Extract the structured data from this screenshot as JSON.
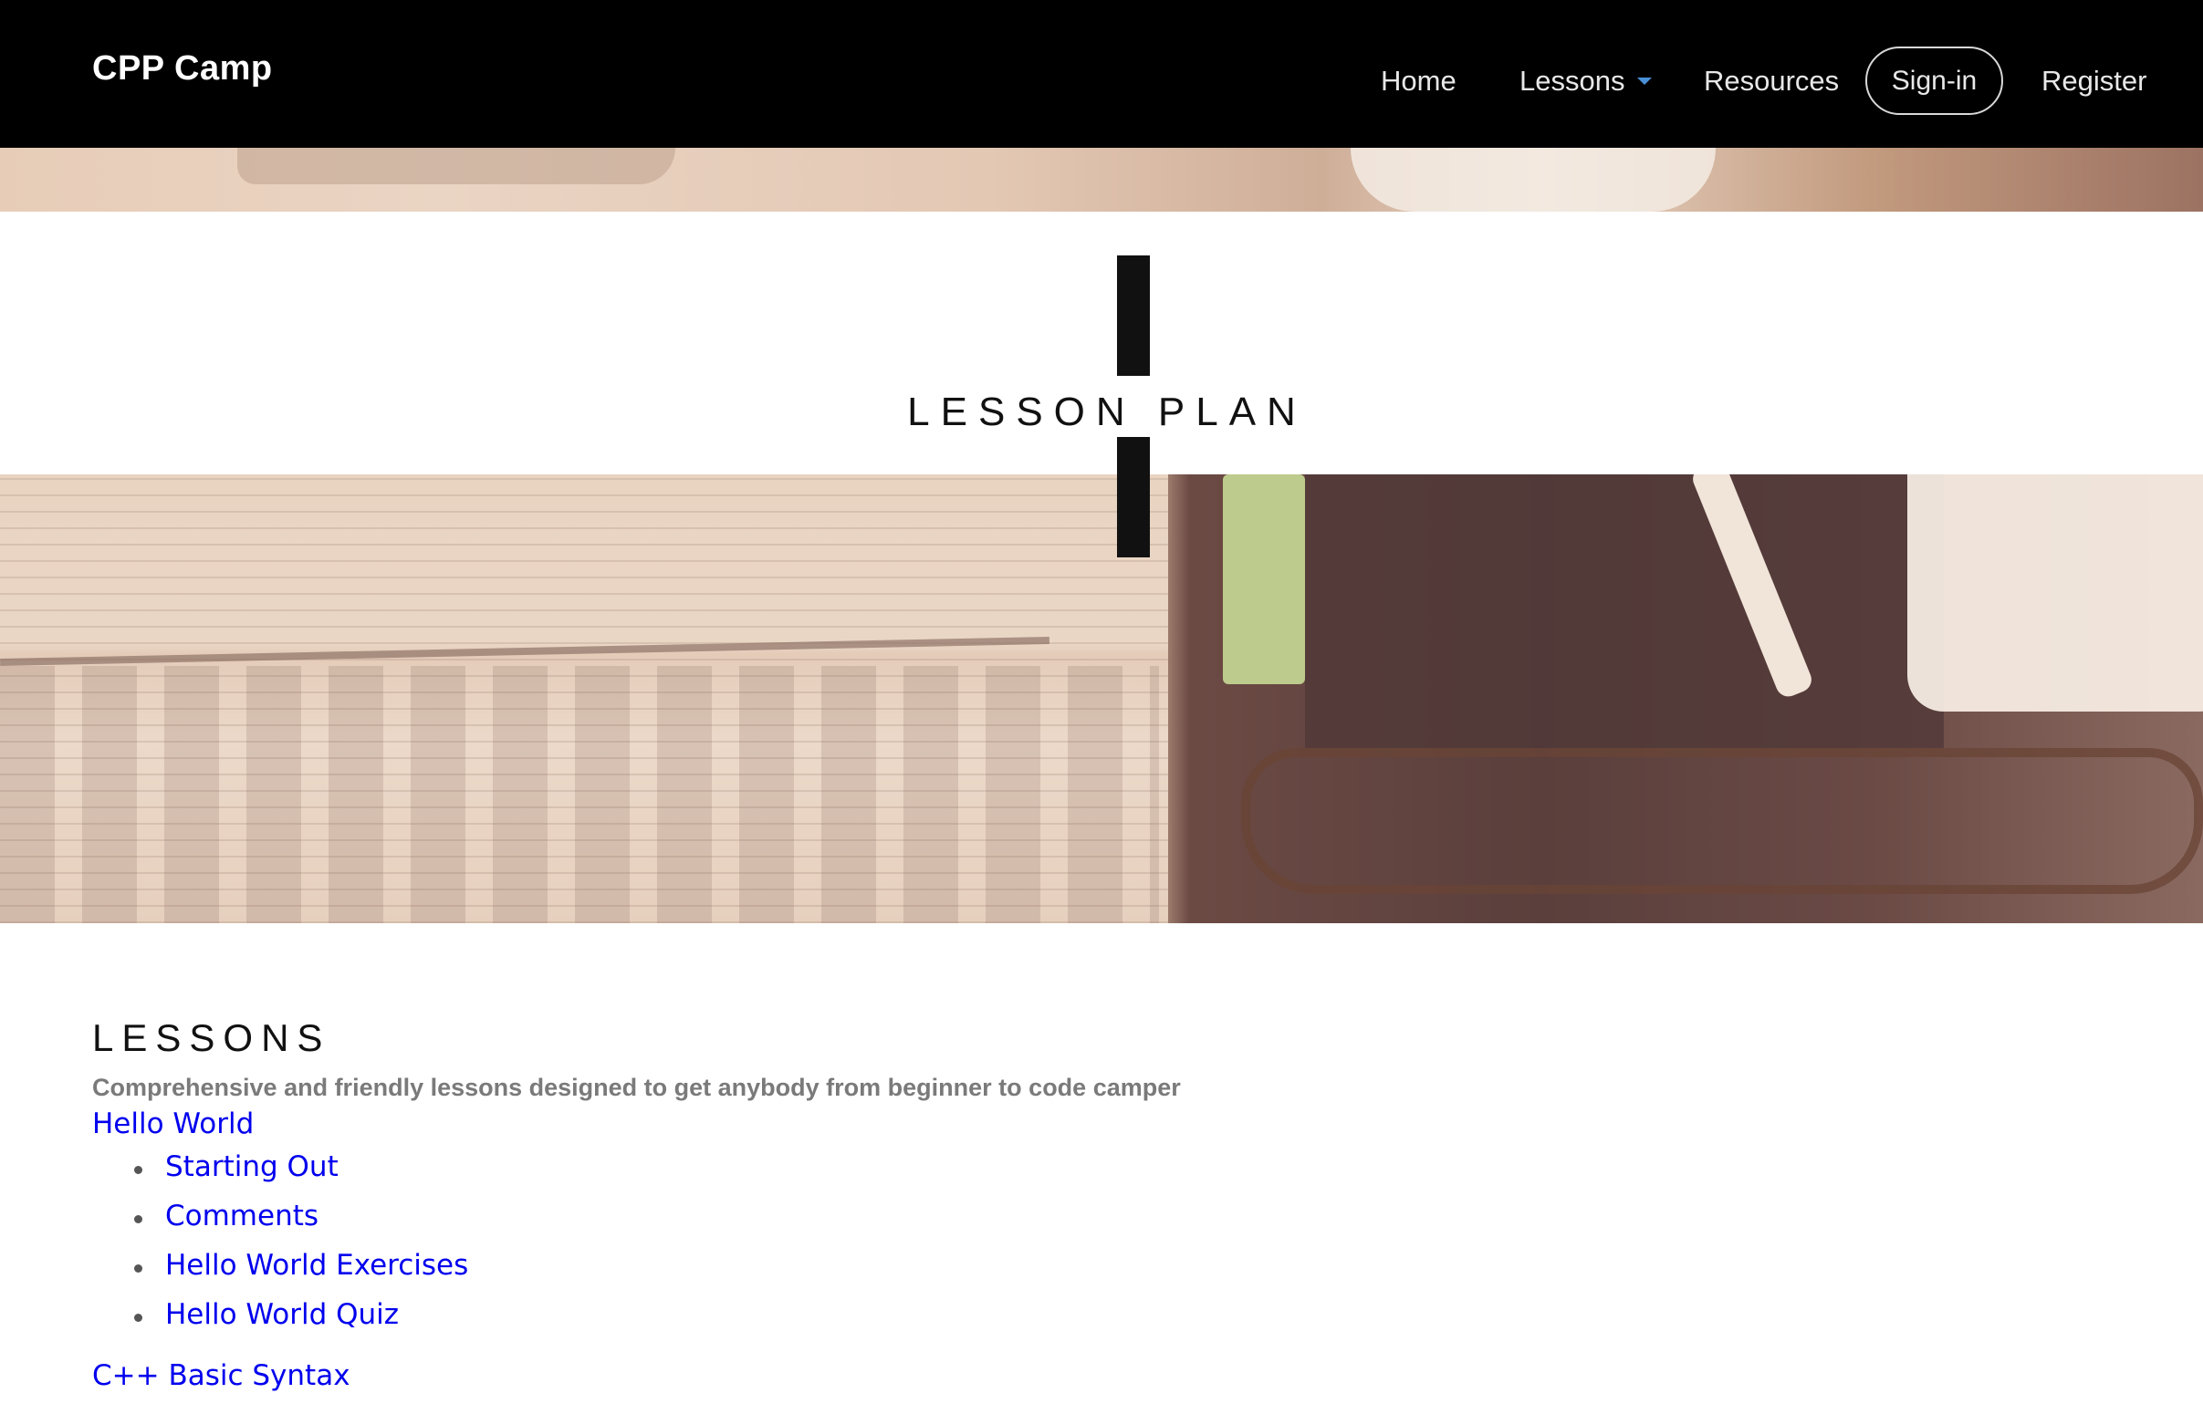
{
  "nav": {
    "brand": "CPP Camp",
    "items": [
      {
        "label": "Home"
      },
      {
        "label": "Lessons"
      },
      {
        "label": "Resources"
      },
      {
        "label": "Sign-in"
      },
      {
        "label": "Register"
      }
    ],
    "accent_color": "#4a90d9"
  },
  "hero": {
    "title": "LESSON PLAN"
  },
  "lessons": {
    "title": "LESSONS",
    "subtitle": "Comprehensive and friendly lessons designed to get anybody from beginner to code camper",
    "groups": [
      {
        "title": "Hello World",
        "items": [
          "Starting Out",
          "Comments",
          "Hello World Exercises",
          "Hello World Quiz"
        ]
      },
      {
        "title": "C++ Basic Syntax"
      }
    ],
    "link_color": "#0000ee"
  }
}
